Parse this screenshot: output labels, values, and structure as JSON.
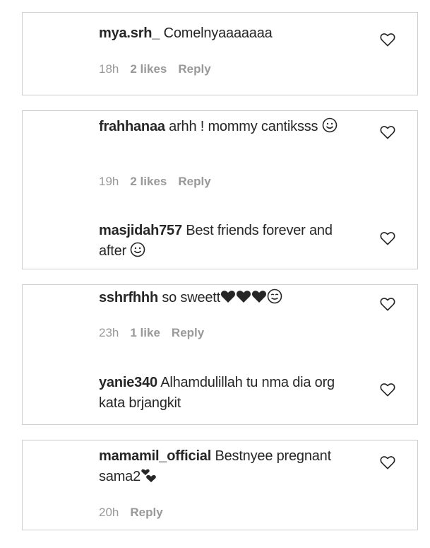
{
  "comments": [
    {
      "username": "mya.srh_",
      "text": "Comelnyaaaaaaa",
      "time": "18h",
      "likes": "2 likes",
      "reply": "Reply"
    },
    {
      "username": "frahhanaa",
      "text": "arhh ! mommy cantiksss",
      "time": "19h",
      "likes": "2 likes",
      "reply": "Reply"
    },
    {
      "username": "masjidah757",
      "text": "Best friends forever and after"
    },
    {
      "username": "sshrfhhh",
      "text": "so sweett",
      "time": "23h",
      "likes": "1 like",
      "reply": "Reply"
    },
    {
      "username": "yanie340",
      "text": "Alhamdulillah tu nma dia org kata brjangkit"
    },
    {
      "username": "mamamil_official",
      "text": "Bestnyee pregnant sama2",
      "time": "20h",
      "reply": "Reply"
    }
  ],
  "icons": {
    "like": "heart-outline-icon",
    "smile": "smiling-face-emoji",
    "hearts": "black-heart-emoji",
    "wink": "winking-face-emoji",
    "revolving": "revolving-hearts-emoji"
  },
  "colors": {
    "text": "#262626",
    "meta": "#999999",
    "border": "#cfcfcf"
  }
}
